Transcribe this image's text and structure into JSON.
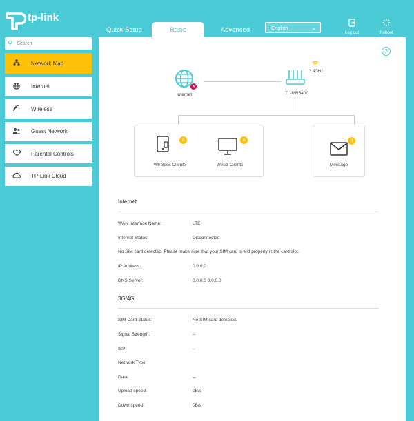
{
  "brand": {
    "name": "tp-link"
  },
  "tabs": [
    {
      "label": "Quick Setup"
    },
    {
      "label": "Basic",
      "active": true
    },
    {
      "label": "Advanced"
    }
  ],
  "language": {
    "value": "English"
  },
  "header_buttons": {
    "logout": "Log out",
    "reboot": "Reboot"
  },
  "search": {
    "placeholder": "Search"
  },
  "sidebar": {
    "items": [
      {
        "label": "Network Map",
        "icon": "network-map-icon",
        "active": true
      },
      {
        "label": "Internet",
        "icon": "globe-icon"
      },
      {
        "label": "Wireless",
        "icon": "wifi-icon"
      },
      {
        "label": "Guest Network",
        "icon": "guest-icon"
      },
      {
        "label": "Parental Controls",
        "icon": "heart-icon"
      },
      {
        "label": "TP-Link Cloud",
        "icon": "cloud-icon"
      }
    ]
  },
  "map": {
    "internet_label": "Internet",
    "router_label": "TL-MR6400",
    "band_label": "2.4GHz",
    "wireless_clients": {
      "label": "Wireless Clients",
      "count": "0"
    },
    "wired_clients": {
      "label": "Wired Clients",
      "count": "0"
    },
    "message": {
      "label": "Message",
      "count": "0"
    },
    "internet_error_mark": "×"
  },
  "internet_section": {
    "title": "Internet",
    "wan_label": "WAN Interface Name:",
    "wan_value": "LTE",
    "status_label": "Internet Status:",
    "status_value": "Disconnected",
    "sim_notice": "No SIM card detected. Please make sure that your SIM card is slid properly in the card slot.",
    "ip_label": "IP Address:",
    "ip_value": "0.0.0.0",
    "dns_label": "DNS Server:",
    "dns_value": "0.0.0.0 0.0.0.0"
  },
  "cell_section": {
    "title": "3G/4G",
    "sim_label": "SIM Card Status:",
    "sim_value": "No SIM card detected.",
    "signal_label": "Signal Strength:",
    "signal_value": "--",
    "isp_label": "ISP:",
    "isp_value": "--",
    "network_type_label": "Network Type:",
    "network_type_value": "",
    "data_label": "Data:",
    "data_value": "--",
    "upload_label": "Upload speed:",
    "upload_value": "0B/s",
    "download_label": "Down speed:",
    "download_value": "0B/s"
  },
  "colors": {
    "teal": "#4acbd6",
    "accent": "#ffc107",
    "error": "#c2185b"
  }
}
